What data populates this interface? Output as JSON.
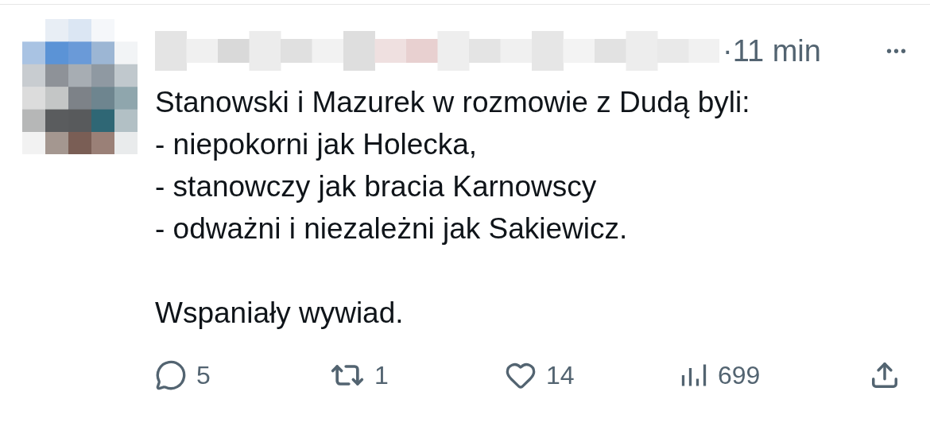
{
  "post": {
    "time": "·11 min",
    "more": "•••",
    "text": "Stanowski i Mazurek w rozmowie z Dudą byli:\n- niepokorni jak Holecka,\n- stanowczy jak bracia Karnowscy\n- odważni i niezależni jak Sakiewicz.\n\nWspaniały wywiad.",
    "actions": [
      {
        "kind": "reply",
        "count": "5"
      },
      {
        "kind": "repost",
        "count": "1"
      },
      {
        "kind": "like",
        "count": "14"
      },
      {
        "kind": "views",
        "count": "699"
      },
      {
        "kind": "share"
      }
    ]
  }
}
